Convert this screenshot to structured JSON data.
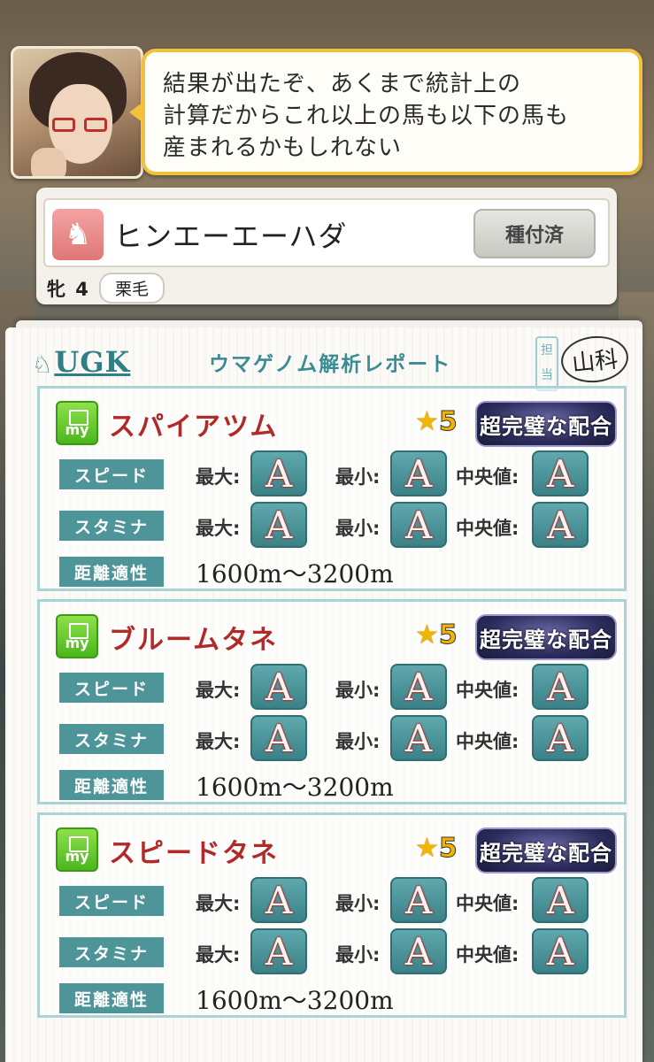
{
  "dialogue": {
    "lines": [
      "結果が出たぞ、あくまで統計上の",
      "計算だからこれ以上の馬も以下の馬も",
      "産まれるかもしれない"
    ]
  },
  "horse": {
    "icon": "horse-icon",
    "name": "ヒンエーエーハダ",
    "status": "種付済",
    "sex_age": "牝 4",
    "coat": "栗毛"
  },
  "report": {
    "logo": "UGK",
    "title": "ウマゲノム解析レポート",
    "stamp_label": "担当",
    "stamp_text": "山科",
    "sections": [
      {
        "icon_label": "my",
        "name": "スパイアツム",
        "stars": "5",
        "badge": "超完璧な配合",
        "speed": {
          "label": "スピード",
          "max_label": "最大:",
          "max": "A",
          "min_label": "最小:",
          "min": "A",
          "median_label": "中央値:",
          "median": "A"
        },
        "stamina": {
          "label": "スタミナ",
          "max_label": "最大:",
          "max": "A",
          "min_label": "最小:",
          "min": "A",
          "median_label": "中央値:",
          "median": "A"
        },
        "distance": {
          "label": "距離適性",
          "value": "1600m〜3200m"
        }
      },
      {
        "icon_label": "my",
        "name": "ブルームタネ",
        "stars": "5",
        "badge": "超完璧な配合",
        "speed": {
          "label": "スピード",
          "max_label": "最大:",
          "max": "A",
          "min_label": "最小:",
          "min": "A",
          "median_label": "中央値:",
          "median": "A"
        },
        "stamina": {
          "label": "スタミナ",
          "max_label": "最大:",
          "max": "A",
          "min_label": "最小:",
          "min": "A",
          "median_label": "中央値:",
          "median": "A"
        },
        "distance": {
          "label": "距離適性",
          "value": "1600m〜3200m"
        }
      },
      {
        "icon_label": "my",
        "name": "スピードタネ",
        "stars": "5",
        "badge": "超完璧な配合",
        "speed": {
          "label": "スピード",
          "max_label": "最大:",
          "max": "A",
          "min_label": "最小:",
          "min": "A",
          "median_label": "中央値:",
          "median": "A"
        },
        "stamina": {
          "label": "スタミナ",
          "max_label": "最大:",
          "max": "A",
          "min_label": "最小:",
          "min": "A",
          "median_label": "中央値:",
          "median": "A"
        },
        "distance": {
          "label": "距離適性",
          "value": "1600m〜3200m"
        }
      }
    ]
  },
  "colors": {
    "accent_teal": "#4e9599",
    "name_red": "#b12a2a",
    "bubble_border": "#f1c23a",
    "star_gold": "#f3b400"
  }
}
